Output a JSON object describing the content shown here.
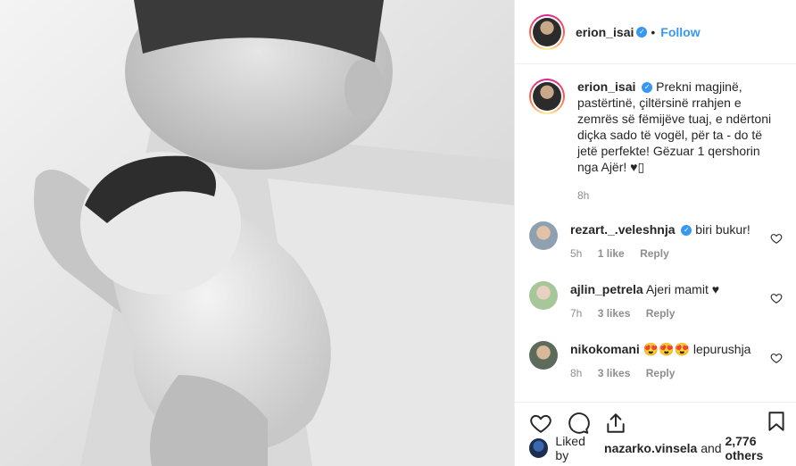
{
  "post": {
    "author": "erion_isai",
    "follow_label": "Follow",
    "separator": "•",
    "caption": "Prekni magjinë, pastërtinë, çiltërsinë rrahjen e zemrës së fëmijëve tuaj, e ndërtoni diçka sado të vogël, për ta - do të jetë perfekte! Gëzuar 1 qershorin nga Ajër! ♥︎▯",
    "caption_time": "8h"
  },
  "comments": [
    {
      "user": "rezart._.veleshnja",
      "verified": true,
      "text": "biri bukur!",
      "time": "5h",
      "likes": "1 like",
      "reply": "Reply",
      "avatar_color": "#9aa5b0"
    },
    {
      "user": "ajlin_petrela",
      "verified": false,
      "text": "Ajeri mamit ♥",
      "time": "7h",
      "likes": "3 likes",
      "reply": "Reply",
      "avatar_color": "#a6c79a"
    },
    {
      "user": "nikokomani",
      "verified": false,
      "text": "😍😍😍 lepurushja",
      "time": "8h",
      "likes": "3 likes",
      "reply": "Reply",
      "avatar_color": "#7b8a7a"
    }
  ],
  "likes_line": {
    "prefix": "Liked by",
    "user": "nazarko.vinsela",
    "middle": "and",
    "count": "2,776 others"
  },
  "icons": {
    "verified": "verified-badge-icon",
    "like": "heart-icon",
    "comment": "comment-icon",
    "share": "share-icon",
    "save": "bookmark-icon"
  },
  "colors": {
    "link": "#3897f0",
    "text": "#262626",
    "muted": "#8e8e8e",
    "border": "#efefef"
  }
}
